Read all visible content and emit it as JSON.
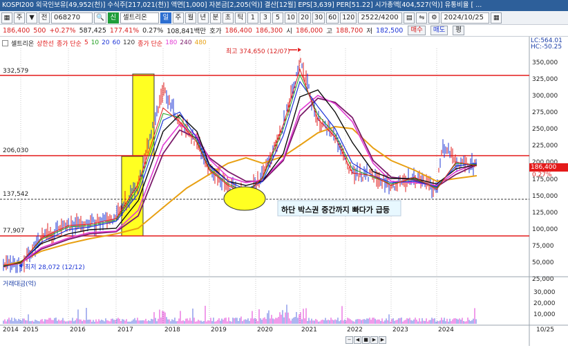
{
  "infobar": {
    "text": "KOSPI200 외국인보유[49,952(천)] 수식주[217,021(천)] 액면[1,000] 자본금[2,205(억)] 결산[12월] EPS[3,639] PER[51.22] 시가총액[404,527(억)] 유통비율 [ ..."
  },
  "toolbar": {
    "grid": "▦",
    "left": "주",
    "sep": "▼",
    "prev": "전",
    "code": "068270",
    "search": "🔍",
    "name": "셀트리온",
    "sin": "신",
    "periods": [
      "일",
      "주",
      "월",
      "년",
      "분",
      "초",
      "틱"
    ],
    "minutes": [
      "1",
      "3",
      "5",
      "10",
      "20",
      "30",
      "60",
      "120"
    ],
    "count": "2522",
    "total": "/4200",
    "date": "2024/10/25"
  },
  "quote": {
    "price": "186,400",
    "change": "500",
    "change_pct": "+0.27%",
    "volume": "587,425",
    "vol_ratio": "177.41%",
    "turnover": "0.27%",
    "amount": "108,841백만",
    "ask_label": "호가",
    "ask": "186,400",
    "bid": "186,300",
    "open_label": "시",
    "open": "186,000",
    "high_label": "고",
    "high": "188,700",
    "low_label": "저",
    "low": "182,500",
    "buy": "매수",
    "sell": "매도",
    "eval": "평"
  },
  "legend": {
    "stock": "셀트리온",
    "type": "상한선",
    "ma_label": "종가 단순",
    "mas": [
      "5",
      "10",
      "20",
      "60",
      "120"
    ],
    "ma2_label": "종가 단순",
    "ma2": [
      "180",
      "240",
      "480"
    ]
  },
  "colors": {
    "ma5": "#e21b1b",
    "ma10": "#1f9e1f",
    "ma20": "#1c34d6",
    "ma60": "#0b0b0b",
    "ma120": "#8a1438",
    "ma180": "#e23ad4",
    "ma240": "#7a1a6a",
    "ma480": "#e8a012",
    "band": "#ffff22",
    "hline": "#e41a1a"
  },
  "right_panel": {
    "lc": "LC:564.01",
    "hc": "HC:-50.25"
  },
  "price_axis": {
    "labels": [
      "350,000",
      "325,000",
      "300,000",
      "275,000",
      "250,000",
      "225,000",
      "200,000",
      "175,000",
      "150,000",
      "125,000",
      "100,000",
      "75,000",
      "50,000",
      "25,000"
    ],
    "current": "186,400",
    "current_pct": "0.27%"
  },
  "hlines": {
    "l1": "332,579",
    "l2": "206,030",
    "l3": "137,542",
    "l4": "77,907"
  },
  "annotations": {
    "high": "최고 374,650 (12/07)",
    "low": "최저 28,072 (12/12)",
    "note": "하단 박스권 중간까지 빠다가 급등"
  },
  "volume": {
    "title": "거래대금(억)",
    "labels": [
      "30,000",
      "20,000",
      "10,000"
    ]
  },
  "x_axis": {
    "years": [
      "2014",
      "2015",
      "2016",
      "2017",
      "2018",
      "2019",
      "2020",
      "2021",
      "2022",
      "2023",
      "2024"
    ],
    "end": "10/25"
  }
}
